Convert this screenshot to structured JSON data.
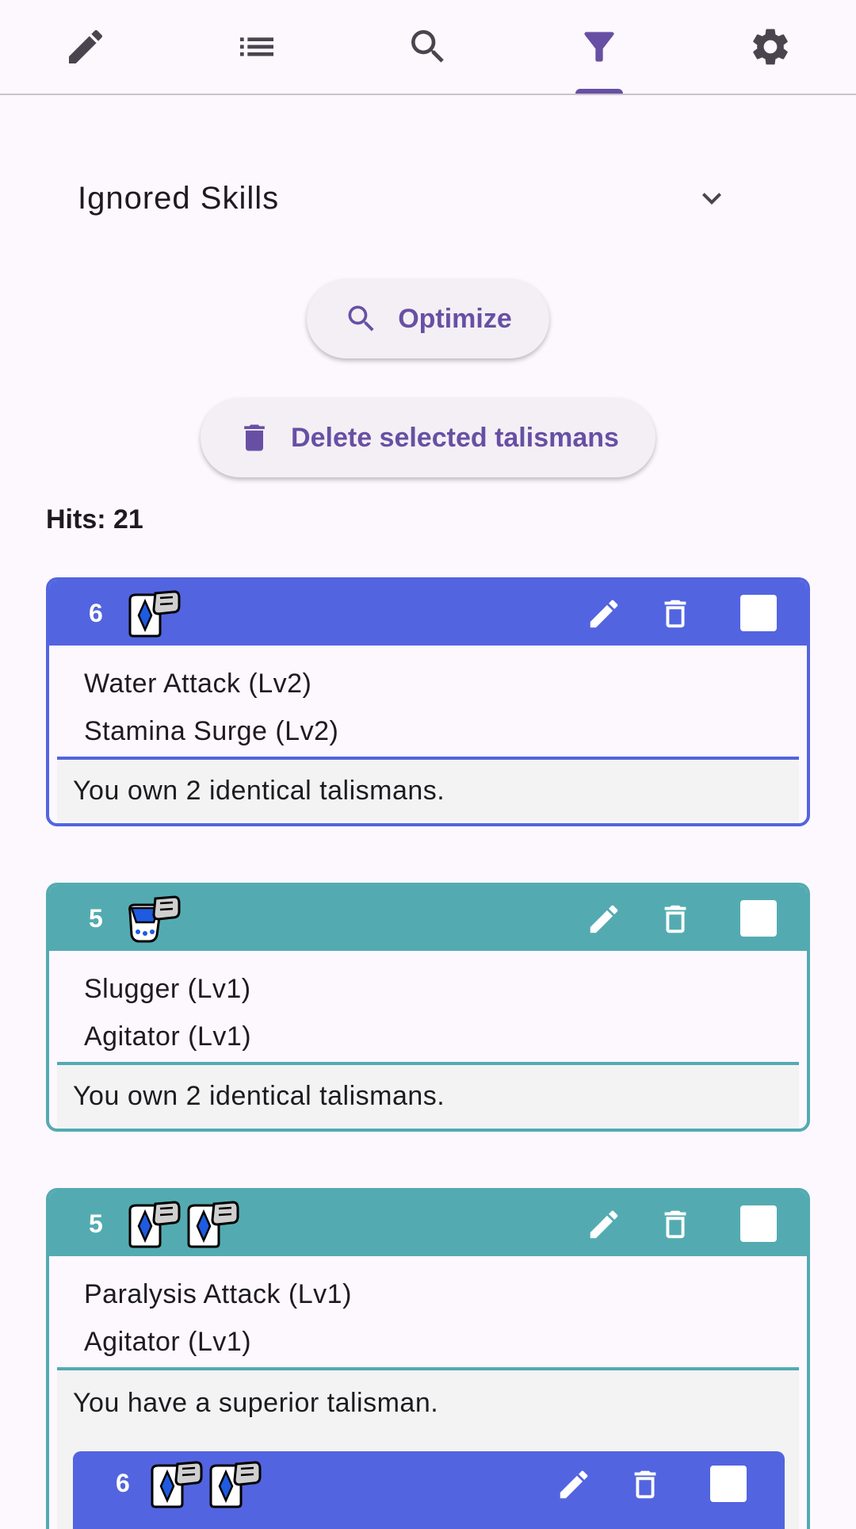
{
  "nav": {
    "tabs": [
      {
        "icon": "pencil-icon",
        "label": "edit"
      },
      {
        "icon": "list-icon",
        "label": "list"
      },
      {
        "icon": "search-icon",
        "label": "search"
      },
      {
        "icon": "filter-icon",
        "label": "filter",
        "active": true
      },
      {
        "icon": "gear-icon",
        "label": "settings"
      }
    ]
  },
  "dropdown": {
    "label": "Ignored Skills"
  },
  "buttons": {
    "optimize_label": "Optimize",
    "delete_label": "Delete selected talismans"
  },
  "hits": {
    "text": "Hits: 21"
  },
  "colors": {
    "accent": "#6750A4",
    "rare6": "#5264E0",
    "rare5": "#53ABB1"
  },
  "talismans": [
    {
      "rarity": "6",
      "slots": [
        "slot-2"
      ],
      "skills": [
        "Water Attack (Lv2)",
        "Stamina Surge (Lv2)"
      ],
      "note": "You own 2 identical talismans."
    },
    {
      "rarity": "5",
      "slots": [
        "slot-3"
      ],
      "skills": [
        "Slugger (Lv1)",
        "Agitator (Lv1)"
      ],
      "note": "You own 2 identical talismans."
    },
    {
      "rarity": "5",
      "slots": [
        "slot-1",
        "slot-1"
      ],
      "skills": [
        "Paralysis Attack (Lv1)",
        "Agitator (Lv1)"
      ],
      "note": "You have a superior talisman.",
      "superior": {
        "rarity": "6",
        "slots": [
          "slot-1",
          "slot-1"
        ]
      }
    }
  ]
}
